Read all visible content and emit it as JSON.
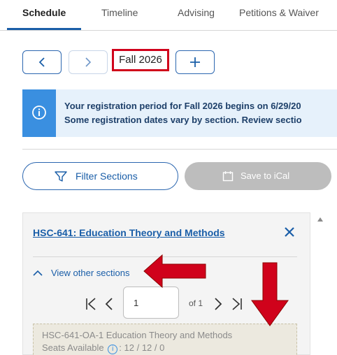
{
  "tabs": [
    {
      "label": "Schedule"
    },
    {
      "label": "Timeline"
    },
    {
      "label": "Advising"
    },
    {
      "label": "Petitions & Waiver"
    }
  ],
  "term": {
    "label": "Fall 2026"
  },
  "alert": {
    "line1": "Your registration period for Fall 2026 begins on 6/29/20",
    "line2": "Some registration dates vary by section. Review sectio"
  },
  "actions": {
    "filter_label": "Filter Sections",
    "ical_label": "Save to iCal"
  },
  "course": {
    "title": "HSC-641: Education Theory and Methods",
    "view_other_label": "View other sections"
  },
  "pager": {
    "current_page": "1",
    "of_label": "of 1"
  },
  "section": {
    "title": "HSC-641-OA-1 Education Theory and Methods",
    "seats_label": "Seats Available",
    "seats_value": ": 12 / 12 / 0"
  },
  "colors": {
    "accent": "#1a5ea8",
    "highlight_red": "#d0021b",
    "alert_bg": "#e6f1fb",
    "alert_bar": "#3a8fe0",
    "disabled_button": "#bdbdbd"
  },
  "icons": {
    "prev": "chevron-left-icon",
    "next": "chevron-right-icon",
    "add": "plus-icon",
    "info": "info-icon",
    "filter": "filter-funnel-icon",
    "calendar": "calendar-icon",
    "close": "close-icon",
    "collapse": "chevron-up-icon",
    "first": "first-page-icon",
    "last": "last-page-icon"
  }
}
